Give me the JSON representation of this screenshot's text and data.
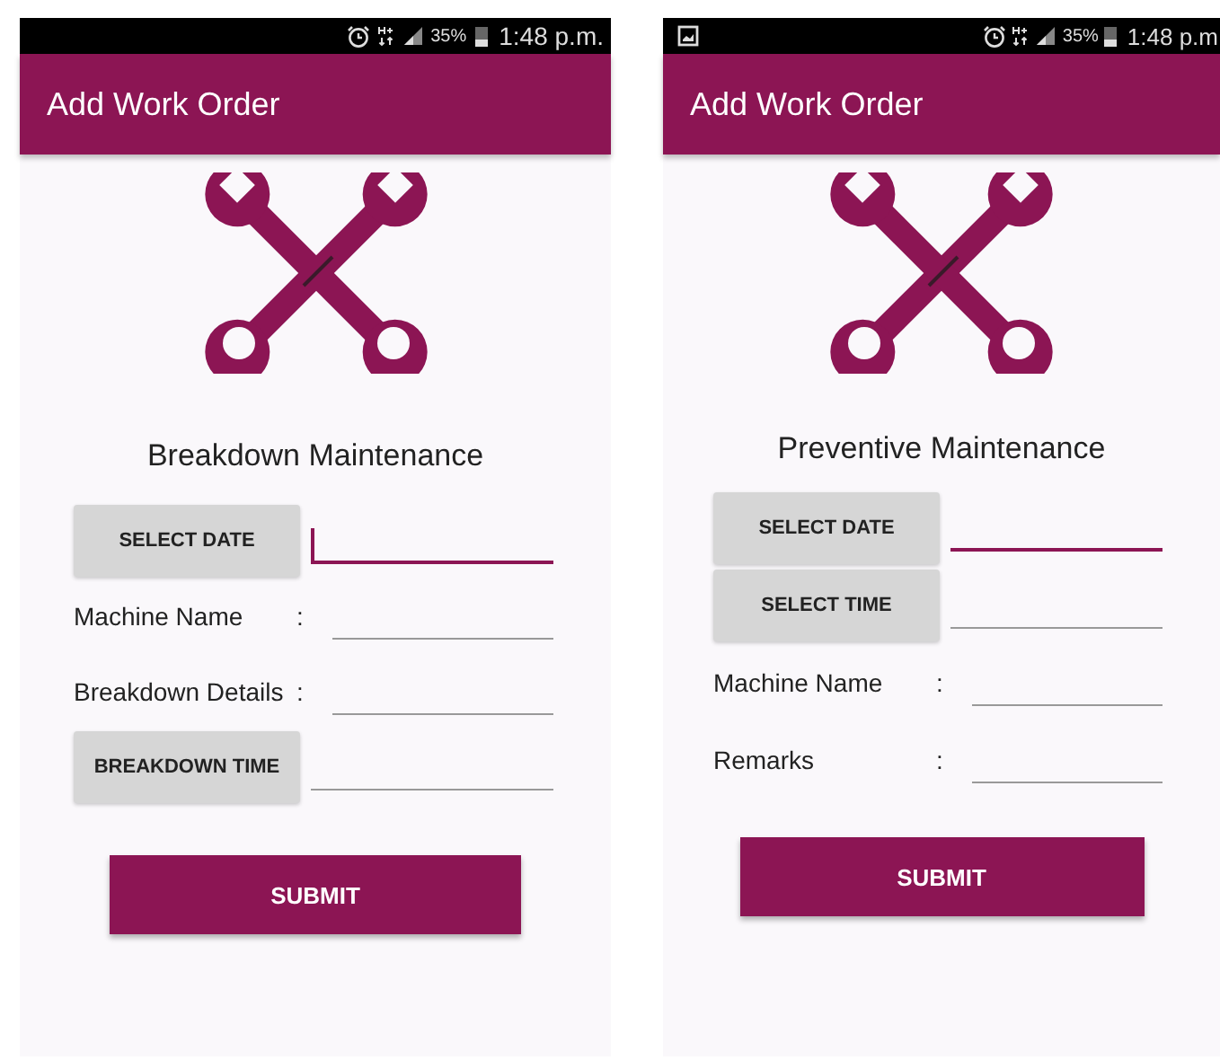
{
  "screens": [
    {
      "status_bar": {
        "screenshot_notification": false,
        "battery": "35%",
        "time": "1:48 p.m."
      },
      "app_bar": {
        "title": "Add Work Order"
      },
      "heading": "Breakdown Maintenance",
      "rows": [
        {
          "kind": "button",
          "button": "SELECT DATE",
          "focused": true,
          "cursor": true
        },
        {
          "kind": "field",
          "label": "Machine Name",
          "colon": ":",
          "focused": false,
          "cursor": false
        },
        {
          "kind": "field",
          "label": "Breakdown Details",
          "colon": ":",
          "focused": false,
          "cursor": false
        },
        {
          "kind": "button",
          "button": "BREAKDOWN TIME",
          "focused": false,
          "cursor": false
        }
      ],
      "submit": "SUBMIT"
    },
    {
      "status_bar": {
        "screenshot_notification": true,
        "battery": "35%",
        "time": "1:48 p.m"
      },
      "app_bar": {
        "title": "Add Work Order"
      },
      "heading": "Preventive Maintenance",
      "rows": [
        {
          "kind": "button",
          "button": "SELECT DATE",
          "focused": true,
          "cursor": false
        },
        {
          "kind": "button",
          "button": "SELECT TIME",
          "focused": false,
          "cursor": false
        },
        {
          "kind": "field",
          "label": "Machine Name",
          "colon": ":",
          "focused": false,
          "cursor": false
        },
        {
          "kind": "field",
          "label": "Remarks",
          "colon": ":",
          "focused": false,
          "cursor": false
        }
      ],
      "submit": "SUBMIT"
    }
  ]
}
